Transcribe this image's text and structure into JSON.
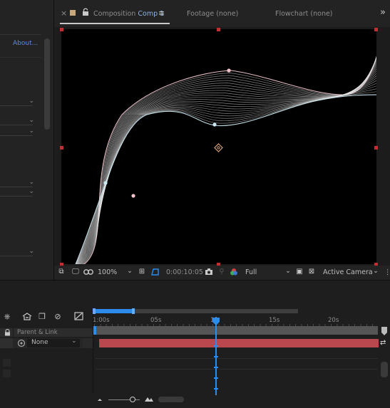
{
  "left_panel": {
    "about_link": "About..."
  },
  "tabs": {
    "close_glyph": "×",
    "composition_prefix": "Composition",
    "composition_name": "Comp 1",
    "menu_glyph": "≡",
    "footage": "Footage (none)",
    "flowchart": "Flowchart (none)",
    "overflow": "»"
  },
  "viewer_toolbar": {
    "zoom": "100%",
    "timecode": "0:00:10:05",
    "resolution": "Full",
    "camera": "Active Camera"
  },
  "timeline": {
    "parent_link_header": "Parent & Link",
    "parent_value": "None",
    "ruler_ticks": [
      "0:00s",
      "05s",
      "10s",
      "15s",
      "20s"
    ],
    "ruler_tick_labels": [
      "1:00s",
      "05s",
      "1",
      "15s",
      "20s"
    ],
    "current_time_fraction": 0.43
  },
  "colors": {
    "accent": "#2d8ceb",
    "layer_bar": "#b8474e",
    "handle": "#c03030",
    "tab_active": "#8fb3e6"
  }
}
